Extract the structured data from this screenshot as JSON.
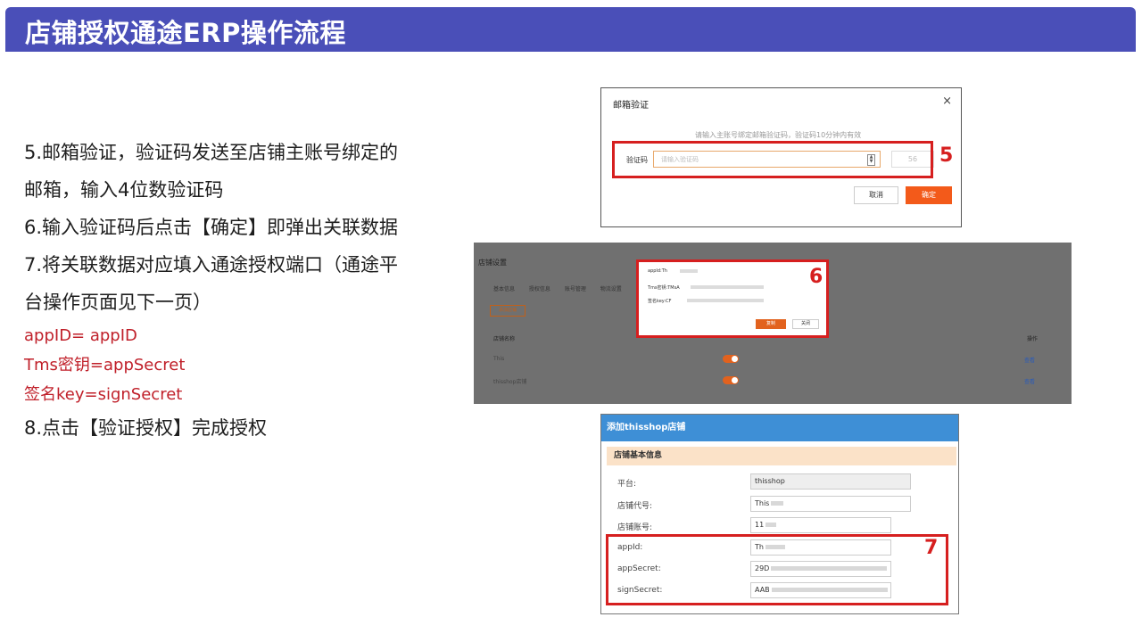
{
  "header": {
    "title": "店铺授权通途ERP操作流程"
  },
  "steps": [
    "5.邮箱验证，验证码发送至店铺主账号绑定的",
    "邮箱，输入4位数验证码",
    "6.输入验证码后点击【确定】即弹出关联数据",
    "7.将关联数据对应填入通途授权端口（通途平",
    "台操作页面见下一页）"
  ],
  "mapping": [
    "appID= appID",
    "Tms密钥=appSecret",
    "签名key=signSecret"
  ],
  "step8": "8.点击【验证授权】完成授权",
  "shot5": {
    "title": "邮箱验证",
    "close": "×",
    "hint": "请输入主账号绑定邮箱验证码，验证码10分钟内有效",
    "code_label": "验证码",
    "code_placeholder": "请输入验证码",
    "countdown": "56",
    "marker": "5",
    "cancel": "取消",
    "confirm": "确定"
  },
  "shot6": {
    "bg_title": "店铺设置",
    "tabs": "基本信息 授权信息 账号管理 物流设置",
    "bg_button": "添加店铺",
    "th_name": "店铺名称",
    "th_op": "操作",
    "rows": [
      "This",
      "thisshop店铺"
    ],
    "row_link": "查看",
    "popup_lines": [
      "appId:Th",
      "Tms密钥:TMsA",
      "签名key:CF"
    ],
    "copy": "复制",
    "close": "关闭",
    "marker": "6"
  },
  "shot7": {
    "title": "添加thisshop店铺",
    "section": "店铺基本信息",
    "fields": [
      {
        "label": "平台:",
        "value": "thisshop"
      },
      {
        "label": "店铺代号:",
        "value": "This"
      },
      {
        "label": "店铺账号:",
        "value": "11"
      },
      {
        "label": "appId:",
        "value": "Th"
      },
      {
        "label": "appSecret:",
        "value": "29D"
      },
      {
        "label": "signSecret:",
        "value": "AAB"
      }
    ],
    "marker": "7"
  }
}
